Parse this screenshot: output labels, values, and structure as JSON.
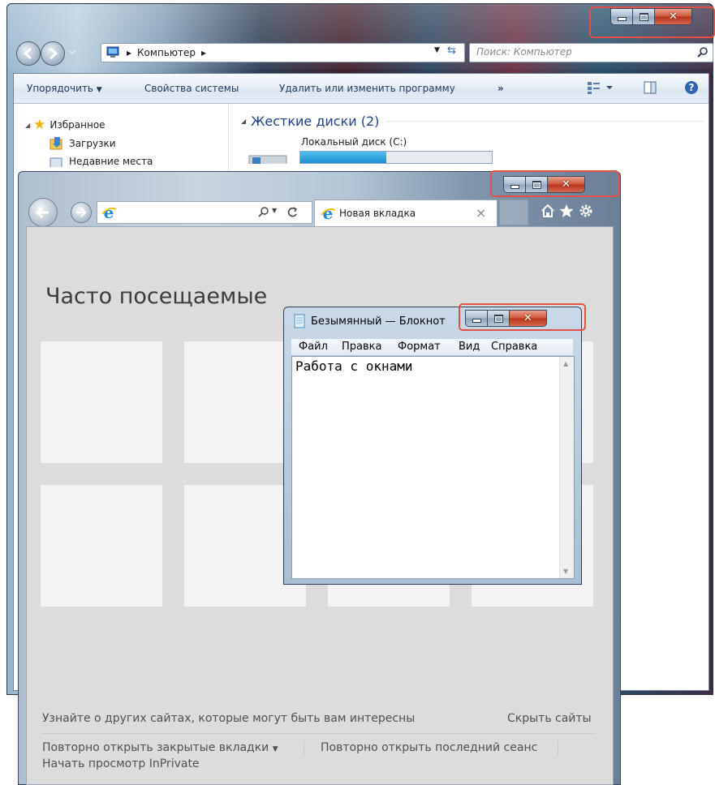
{
  "explorer": {
    "breadcrumb": "Компьютер",
    "search_placeholder": "Поиск: Компьютер",
    "toolbar": {
      "organize": "Упорядочить",
      "system_properties": "Свойства системы",
      "uninstall": "Удалить или изменить программу",
      "more": "»"
    },
    "nav": {
      "favorites": "Избранное",
      "downloads": "Загрузки",
      "recent_places": "Недавние места"
    },
    "section_header": "Жесткие диски (2)",
    "drive_label": "Локальный диск (C:)",
    "drive_fill_fraction": 0.45
  },
  "ie": {
    "tab_title": "Новая вкладка",
    "tab_close": "×",
    "heading": "Часто посещаемые",
    "discover_link": "Узнайте о других сайтах, которые могут быть вам интересны",
    "hide_sites": "Скрыть сайты",
    "reopen_tabs": "Повторно открыть закрытые вкладки",
    "reopen_session": "Повторно открыть последний сеанс",
    "inprivate": "Начать просмотр InPrivate"
  },
  "notepad": {
    "title": "Безымянный — Блокнот",
    "menu": [
      "Файл",
      "Правка",
      "Формат",
      "Вид",
      "Справка"
    ],
    "content": "Работа с окнами"
  },
  "colors": {
    "highlight": "#e54f45",
    "ie_blue": "#1e88e5",
    "explorer_link": "#1e395b"
  }
}
